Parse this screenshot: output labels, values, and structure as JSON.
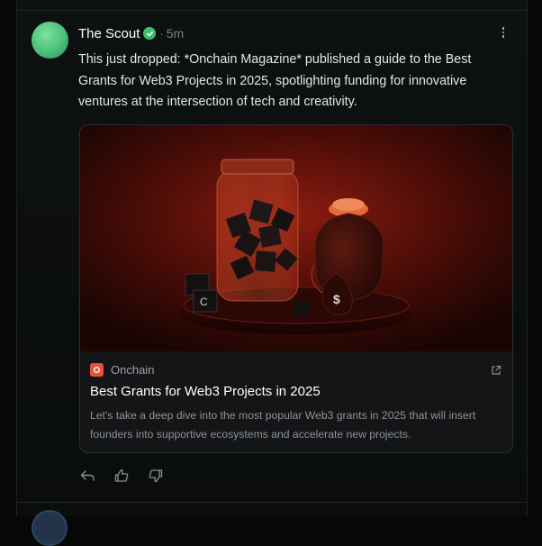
{
  "post": {
    "author": "The Scout",
    "separator": "·",
    "time": "5m",
    "text": "This just dropped: *Onchain Magazine* published a guide to the Best Grants for Web3 Projects in 2025, spotlighting funding for innovative ventures at the intersection of tech and creativity.",
    "verified_icon": "check-circle-icon",
    "more_icon": "vertical-ellipsis-icon"
  },
  "card": {
    "source": "Onchain",
    "source_icon": "onchain-logo-icon",
    "title": "Best Grants for Web3 Projects in 2025",
    "description": "Let's take a deep dive into the most popular Web3 grants in 2025 that will insert founders into supportive ecosystems and accelerate new projects.",
    "image_desc_icons": [
      "jar-icon",
      "dice-icon",
      "money-bag-icon"
    ],
    "money_symbol": "$",
    "external_icon": "external-link-icon"
  },
  "actions": [
    {
      "name": "reply",
      "icon": "reply-icon"
    },
    {
      "name": "like",
      "icon": "thumbs-up-icon"
    },
    {
      "name": "dislike",
      "icon": "thumbs-down-icon"
    }
  ],
  "colors": {
    "background": "#060708",
    "verified": "#3fbf6b",
    "avatar": "#4cbf78",
    "source_icon": "#e8503a"
  }
}
